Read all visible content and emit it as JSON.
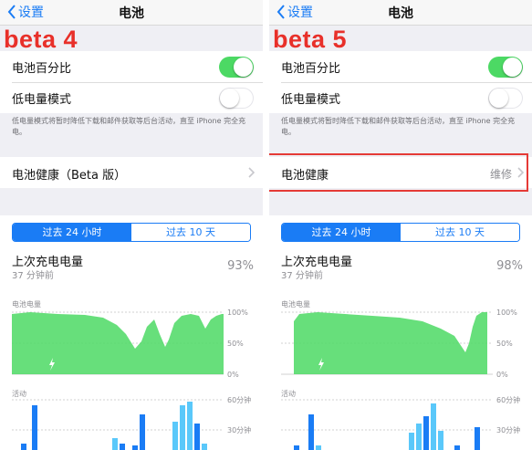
{
  "panels": [
    {
      "id": "left",
      "nav": {
        "back_label": "设置",
        "title": "电池"
      },
      "beta_label": "beta 4",
      "rows": {
        "percentage_label": "电池百分比",
        "percentage_on": true,
        "low_power_label": "低电量模式",
        "low_power_on": false
      },
      "note": "低电量模式将暂时降低下载和邮件获取等后台活动，直至 iPhone 完全充电。",
      "health": {
        "label": "电池健康（Beta 版）",
        "value": "",
        "highlighted": false
      },
      "segment": {
        "option1": "过去 24 小时",
        "option2": "过去 10 天",
        "selected": 0
      },
      "last_charge": {
        "title": "上次充电电量",
        "time": "37 分钟前",
        "percent": "93%"
      },
      "battery_chart": {
        "label": "电池电量",
        "ticks": [
          "100%",
          "50%",
          "0%"
        ]
      },
      "activity_chart": {
        "label": "活动",
        "ticks": [
          "60分钟",
          "30分钟"
        ]
      }
    },
    {
      "id": "right",
      "nav": {
        "back_label": "设置",
        "title": "电池"
      },
      "beta_label": "beta 5",
      "rows": {
        "percentage_label": "电池百分比",
        "percentage_on": true,
        "low_power_label": "低电量模式",
        "low_power_on": false
      },
      "note": "低电量模式将暂时降低下载和邮件获取等后台活动，直至 iPhone 完全充电。",
      "health": {
        "label": "电池健康",
        "value": "维修",
        "highlighted": true
      },
      "segment": {
        "option1": "过去 24 小时",
        "option2": "过去 10 天",
        "selected": 0
      },
      "last_charge": {
        "title": "上次充电电量",
        "time": "37 分钟前",
        "percent": "98%"
      },
      "battery_chart": {
        "label": "电池电量",
        "ticks": [
          "100%",
          "50%",
          "0%"
        ]
      },
      "activity_chart": {
        "label": "活动",
        "ticks": [
          "60分钟",
          "30分钟"
        ]
      }
    }
  ],
  "colors": {
    "accent": "#1a7cf5",
    "toggle_on": "#4cd964",
    "battery_fill": "#4cd964",
    "activity_screen_on": "#1a7cf5",
    "activity_screen_off": "#5ac8fa",
    "highlight_red": "#e53a36",
    "beta_red": "#e8302a"
  },
  "icons": [
    "chevron-left-icon",
    "chevron-right-icon",
    "charging-bolt-icon"
  ]
}
